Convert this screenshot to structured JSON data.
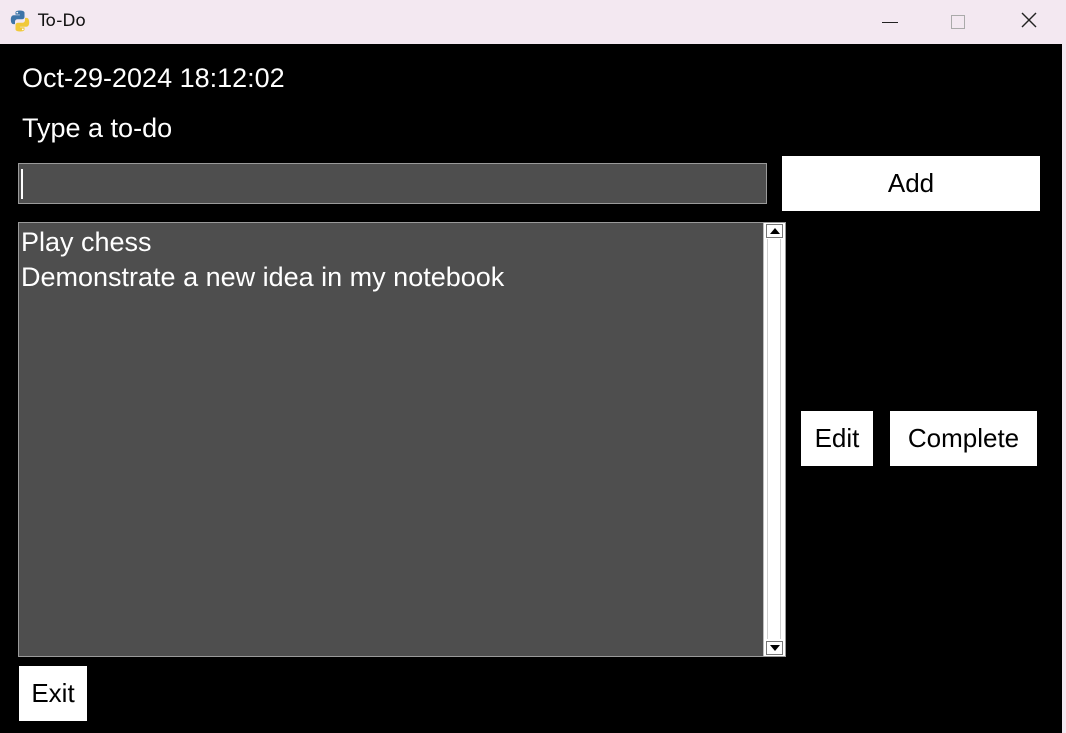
{
  "window": {
    "title": "To-Do",
    "icon": "python-icon",
    "controls": [
      "minimize-icon",
      "maximize-icon",
      "close-icon"
    ]
  },
  "app": {
    "datetime": "Oct-29-2024 18:12:02",
    "prompt": "Type a to-do",
    "input": {
      "value": "",
      "placeholder": ""
    },
    "buttons": {
      "add": "Add",
      "edit": "Edit",
      "complete": "Complete",
      "exit": "Exit"
    },
    "todos": [
      "Play chess",
      "Demonstrate a new idea in my notebook"
    ]
  },
  "colors": {
    "background": "#000000",
    "field": "#4e4e4e",
    "button": "#ffffff",
    "text": "#ffffff",
    "titlebar": "#f3e8f1"
  }
}
